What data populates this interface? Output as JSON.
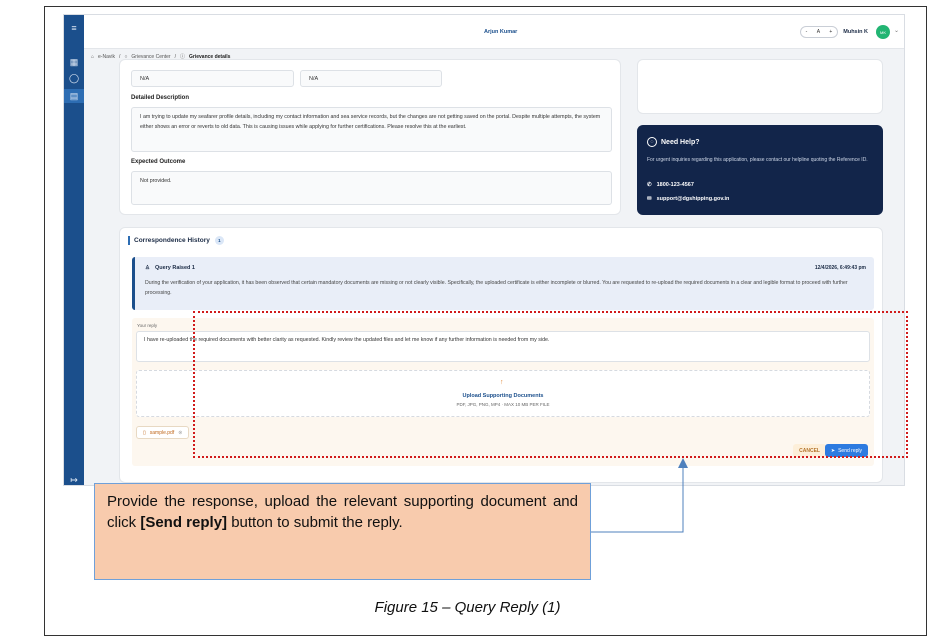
{
  "app": {
    "center_user": "Arjun Kumar",
    "font_controls": [
      "-",
      "A",
      "+"
    ],
    "profile_name": "Muhsin K",
    "avatar_initials": "MK"
  },
  "breadcrumb": {
    "items": [
      "e-Navik",
      "Grievance Center",
      "Grievance details"
    ],
    "separator": "/"
  },
  "details": {
    "field_1_value": "N/A",
    "field_2_value": "N/A",
    "description_label": "Detailed Description",
    "description_text": "I am trying to update my seafarer profile details, including my contact information and sea service records, but the changes are not getting saved on the portal. Despite multiple attempts, the system either shows an error or reverts to old data. This is causing issues while applying for further certifications. Please resolve this at the earliest.",
    "outcome_label": "Expected Outcome",
    "outcome_text": "Not provided."
  },
  "help": {
    "title": "Need Help?",
    "text": "For urgent inquiries regarding this application, please contact our helpline quoting the Reference ID.",
    "phone": "1800-123-4567",
    "email": "support@dgshipping.gov.in"
  },
  "correspondence": {
    "title": "Correspondence History",
    "count": "1",
    "query_title": "Query Raised 1",
    "query_time": "12/4/2026, 6:49:43 pm",
    "query_text": "During the verification of your application, it has been observed that certain mandatory documents are missing or not clearly visible. Specifically, the uploaded certificate is either incomplete or blurred. You are requested to re-upload the required documents in a clear and legible format to proceed with further processing."
  },
  "reply": {
    "label": "Your reply",
    "text": "I have re-uploaded the required documents with better clarity as requested. Kindly review the updated files and let me know if any further information is needed from my side.",
    "upload_title": "Upload Supporting Documents",
    "upload_sub": "PDF, JPG, PNG, MP4 · MAX 10 MB PER FILE",
    "file_name": "sample.pdf",
    "cancel_label": "CANCEL",
    "send_label": "Send reply"
  },
  "annotation": {
    "callout_part1": "Provide the response, upload the relevant supporting document and click ",
    "callout_bold": "[Send reply]",
    "callout_part2": " button to submit the reply.",
    "caption": "Figure 15 – Query Reply (1)"
  },
  "colors": {
    "sidebar": "#1b4f8c",
    "help_card": "#12254a",
    "send_button": "#2d7be0",
    "highlight": "#d11b1b",
    "callout_bg": "#f8cbad"
  }
}
